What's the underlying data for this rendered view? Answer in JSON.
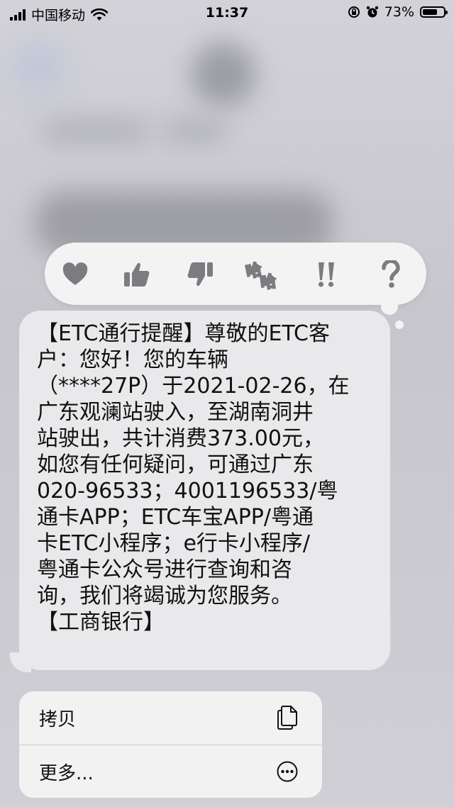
{
  "status_bar": {
    "carrier": "中国移动",
    "time": "11:37",
    "battery_percent": "73%",
    "battery_level": 0.73
  },
  "tapback": {
    "items": [
      {
        "name": "heart",
        "icon": "heart-icon"
      },
      {
        "name": "thumbs-up",
        "icon": "thumbs-up-icon"
      },
      {
        "name": "thumbs-down",
        "icon": "thumbs-down-icon"
      },
      {
        "name": "haha",
        "icon": "haha-icon",
        "text": "哈哈"
      },
      {
        "name": "exclamation",
        "icon": "double-exclamation-icon",
        "text": "!!"
      },
      {
        "name": "question",
        "icon": "question-icon",
        "text": "?"
      }
    ]
  },
  "message": {
    "lines": [
      "【ETC通行提醒】尊敬的ETC客",
      "户：您好！您的车辆",
      "（****27P）于2021-02-26，在",
      "广东观澜站驶入，至湖南洞井",
      "站驶出，共计消费373.00元，",
      "如您有任何疑问，可通过广东",
      "020-96533；4001196533/粤",
      "通卡APP；ETC车宝APP/粤通",
      "卡ETC小程序；e行卡小程序/",
      "粤通卡公众号进行查询和咨",
      "询，我们将竭诚为您服务。",
      "【工商银行】"
    ]
  },
  "menu": {
    "copy_label": "拷贝",
    "more_label": "更多..."
  },
  "colors": {
    "bubble": "#e9e9eb",
    "tapback_bg": "#f3f3f4",
    "icon_gray": "#7b7b80"
  }
}
